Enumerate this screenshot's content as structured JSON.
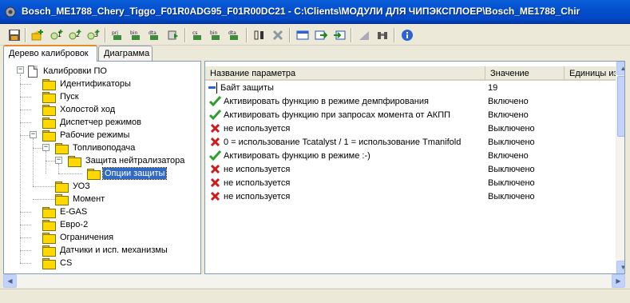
{
  "window": {
    "title": "Bosch_ME1788_Chery_Tiggo_F01R0ADG95_F01R00DC21 - C:\\Clients\\МОДУЛИ ДЛЯ ЧИПЭКСПЛОЕР\\Bosch_ME1788_Chir"
  },
  "toolbar": {
    "icons": [
      "save-icon",
      "add-icon",
      "add-1-icon",
      "add-2-icon",
      "add-3-icon",
      "prj-icon",
      "bin-icon",
      "dta-icon",
      "run-icon",
      "cs-icon",
      "bin-2-icon",
      "dta-2-icon",
      "compare-icon",
      "delete-icon",
      "window-icon",
      "export-icon",
      "import-icon",
      "graph-icon",
      "binoculars-icon",
      "info-icon"
    ]
  },
  "tabs": [
    {
      "label": "Дерево калибровок",
      "active": true
    },
    {
      "label": "Диаграмма",
      "active": false
    }
  ],
  "tree": {
    "root": "Калибровки ПО",
    "items": [
      {
        "label": "Идентификаторы"
      },
      {
        "label": "Пуск"
      },
      {
        "label": "Холостой ход"
      },
      {
        "label": "Диспетчер режимов"
      },
      {
        "label": "Рабочие режимы"
      },
      {
        "label": "Топливоподача"
      },
      {
        "label": "Защита нейтрализатора"
      },
      {
        "label": "Опции защиты",
        "selected": true
      },
      {
        "label": "УОЗ"
      },
      {
        "label": "Момент"
      },
      {
        "label": "E-GAS"
      },
      {
        "label": "Евро-2"
      },
      {
        "label": "Ограничения"
      },
      {
        "label": "Датчики и исп. механизмы"
      },
      {
        "label": "CS"
      }
    ]
  },
  "grid": {
    "columns": [
      "Название параметра",
      "Значение",
      "Единицы из"
    ],
    "rows": [
      {
        "icon": "cursor-icon",
        "name": "Байт защиты",
        "value": "19"
      },
      {
        "icon": "check-icon",
        "name": "Активировать функцию в режиме демпфирования",
        "value": "Включено"
      },
      {
        "icon": "check-icon",
        "name": "Активировать функцию при запросах момента от АКПП",
        "value": "Включено"
      },
      {
        "icon": "cross-icon",
        "name": "не используется",
        "value": "Выключено"
      },
      {
        "icon": "cross-icon",
        "name": "0 = использование Tcatalyst / 1 = использование Tmanifold",
        "value": "Выключено"
      },
      {
        "icon": "check-icon",
        "name": "Активировать функцию в режиме :-)",
        "value": "Включено"
      },
      {
        "icon": "cross-icon",
        "name": "не используется",
        "value": "Выключено"
      },
      {
        "icon": "cross-icon",
        "name": "не используется",
        "value": "Выключено"
      },
      {
        "icon": "cross-icon",
        "name": "не используется",
        "value": "Выключено"
      }
    ]
  },
  "colors": {
    "titlebar": "#0450cf",
    "selection": "#316ac5",
    "check": "#2e9e2e",
    "cross": "#d01a1a",
    "folder": "#ffd800"
  }
}
